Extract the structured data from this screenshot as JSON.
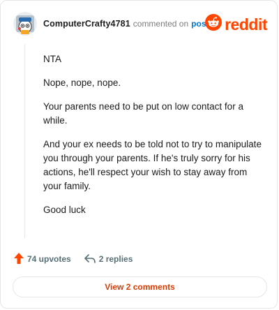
{
  "header": {
    "username": "ComputerCrafty4781",
    "commented_text": "commented on",
    "post_link": "post",
    "avatar_icon": "snoo-avatar-icon"
  },
  "brand": {
    "logo_icon": "reddit-snoo-logo-icon",
    "wordmark": "reddit",
    "color": "#ff4500"
  },
  "comment": {
    "paragraphs": [
      "NTA",
      "Nope, nope, nope.",
      "Your parents need to be put on low contact for a while.",
      "And your ex needs to be told not to try to manipulate you through your parents. If he's truly sorry for his actions, he'll respect your wish to stay away from your family.",
      "Good luck"
    ]
  },
  "actions": {
    "upvotes_label": "74 upvotes",
    "upvote_icon": "upvote-arrow-icon",
    "upvote_color": "#ff4500",
    "replies_label": "2 replies",
    "reply_icon": "reply-arrow-icon"
  },
  "view_comments": {
    "label": "View 2 comments",
    "color": "#d93a00"
  }
}
